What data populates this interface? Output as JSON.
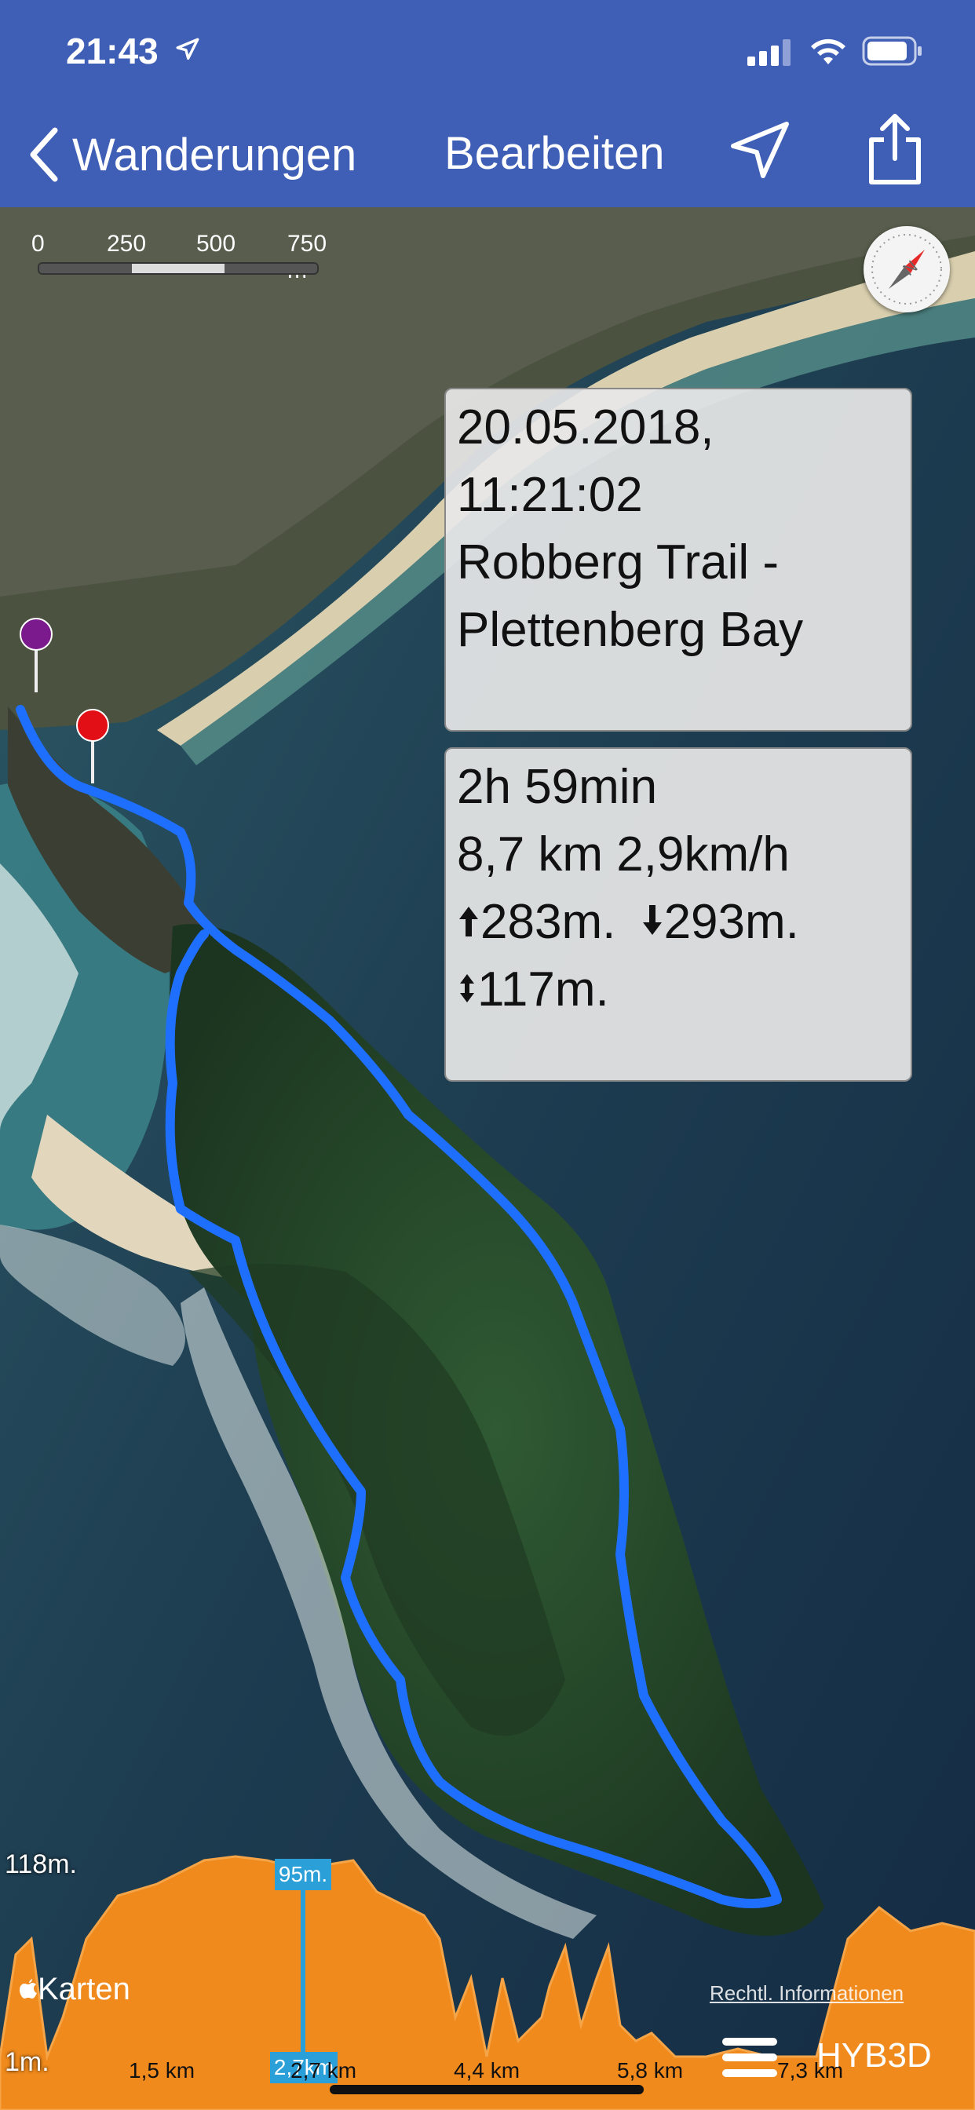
{
  "status_bar": {
    "time": "21:43"
  },
  "nav": {
    "back_label": "Wanderungen",
    "edit_label": "Bearbeiten"
  },
  "scale": {
    "labels": [
      "0",
      "250",
      "500",
      "750 m"
    ]
  },
  "track_info": {
    "date": "20.05.2018,",
    "time": "11:21:02",
    "name_line1": "Robberg Trail -",
    "name_line2": "Plettenberg Bay"
  },
  "track_stats": {
    "duration": "2h 59min",
    "distance_speed": "8,7 km 2,9km/h",
    "ascent": "283m.",
    "descent": "293m.",
    "elevation_range": "117m."
  },
  "elevation_profile": {
    "max_label": "118m.",
    "min_label": "1m.",
    "cursor_elevation": "95m.",
    "cursor_distance": "2,7km",
    "distance_ticks": [
      "1,5 km",
      "2,7 km",
      "4,4 km",
      "5,8 km",
      "7,3 km"
    ]
  },
  "map_overlay": {
    "attribution": "Karten",
    "legal": "Rechtl. Informationen",
    "map_type": "HYB3D"
  },
  "colors": {
    "nav_bar": "#3f5fb7",
    "track": "#1f6fff",
    "profile_fill": "#f08a1c",
    "cursor": "#2a9fd8"
  }
}
